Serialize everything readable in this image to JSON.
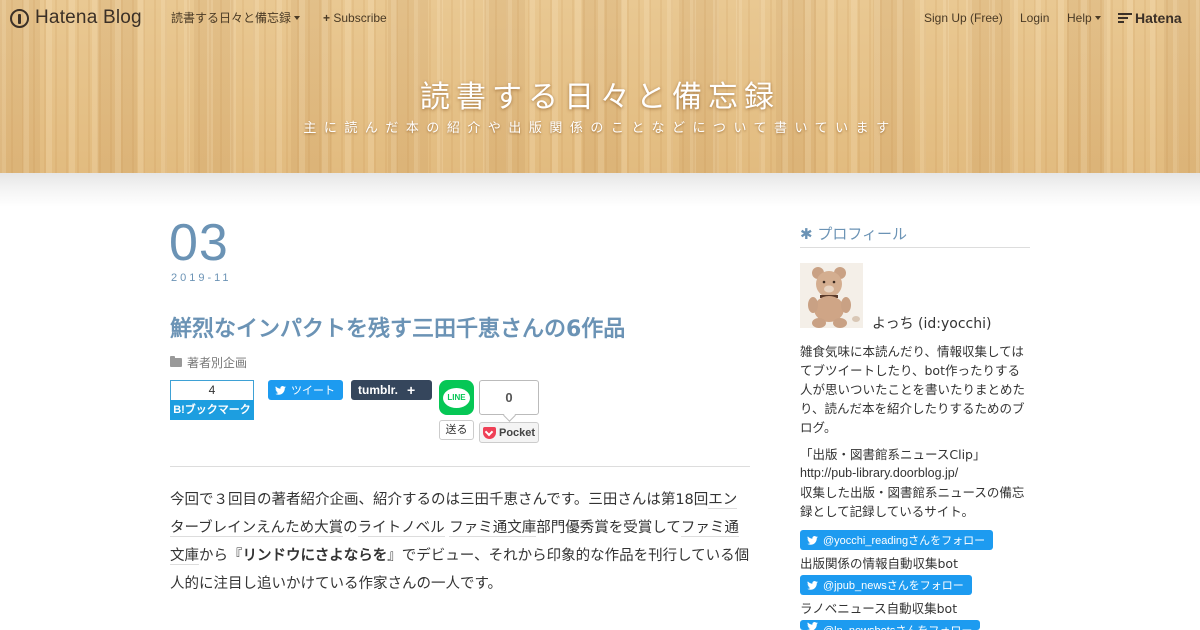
{
  "topbar": {
    "logo_text": "Hatena Blog",
    "blog_menu": "読書する日々と備忘録",
    "subscribe": "Subscribe",
    "signup": "Sign Up (Free)",
    "login": "Login",
    "help": "Help",
    "hatena": "Hatena"
  },
  "header": {
    "title": "読書する日々と備忘録",
    "description": "主に読んだ本の紹介や出版関係のことなどについて書いています"
  },
  "entry": {
    "day": "03",
    "year_month": "2019-11",
    "title": "鮮烈なインパクトを残す三田千恵さんの6作品",
    "category": "著者別企画",
    "share": {
      "hatena_count": "4",
      "hatena_label": "B!ブックマーク",
      "tweet": "ツイート",
      "tumblr": "tumblr.",
      "line_icon": "LINE",
      "line_send": "送る",
      "pocket_count": "0",
      "pocket_label": "Pocket"
    },
    "body": {
      "p1": "今回で３回目の著者紹介企画、紹介するのは三田千恵さんです。三田さんは第18回",
      "kw1": "エンターブレインえんため大賞",
      "p2": "の",
      "kw2": "ライトノベル",
      "p3": " ",
      "kw3": "ファミ通文庫",
      "p4": "部門優秀賞を受賞して",
      "kw4": "ファミ通文庫",
      "p5": "から『",
      "bold1": "リンドウにさよならを",
      "p6": "』でデビュー、それから印象的な作品を刊行している個人的に注目し追いかけている作家さんの一人です。"
    }
  },
  "sidebar": {
    "section_title": "プロフィール",
    "name": "よっち (id:yocchi)",
    "bio": "雑食気味に本読んだり、情報収集してはてブツイートしたり、bot作ったりする人が思いついたことを書いたりまとめたり、読んだ本を紹介したりするためのブログ。",
    "clip_title": "「出版・図書館系ニュースClip」",
    "clip_url": "http://pub-library.doorblog.jp/",
    "clip_desc": "収集した出版・図書館系ニュースの備忘録として記録しているサイト。",
    "follow1": "@yocchi_readingさんをフォロー",
    "bot1_label": "出版関係の情報自動収集bot",
    "follow2": "@jpub_newsさんをフォロー",
    "bot2_label": "ラノベニュース自動収集bot",
    "follow3": "@ln_newsbotsさんをフォロー"
  },
  "colors": {
    "accent": "#6b93b5",
    "twitter": "#1d9bf0",
    "hatena_bookmark": "#1d9ee0",
    "tumblr": "#35465c",
    "line": "#06c755",
    "pocket": "#ef4056"
  }
}
